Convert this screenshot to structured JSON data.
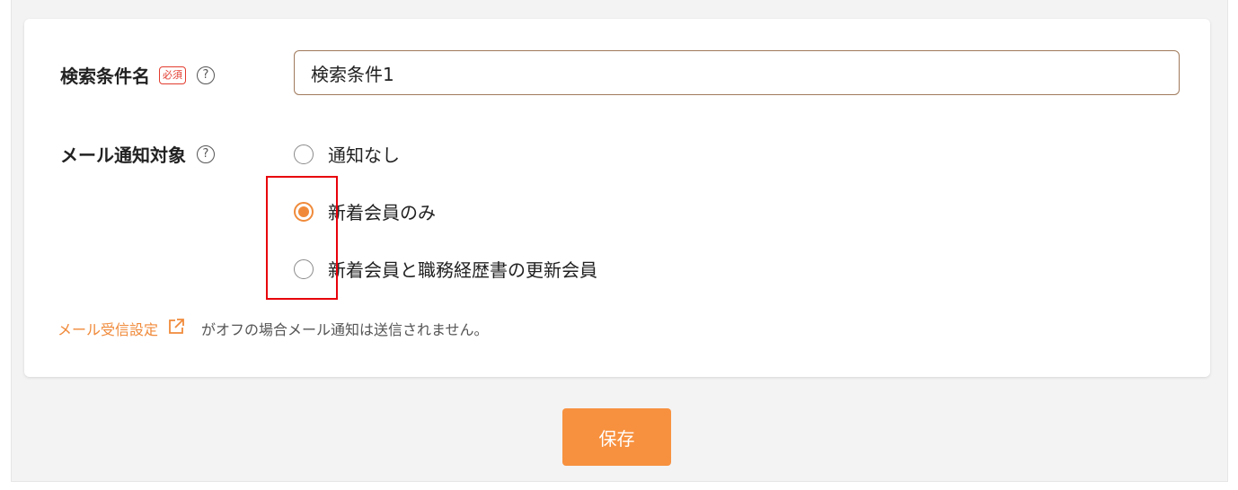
{
  "form": {
    "search_name": {
      "label": "検索条件名",
      "required_badge": "必須",
      "help": "?",
      "value": "検索条件1"
    },
    "mail_target": {
      "label": "メール通知対象",
      "help": "?",
      "options": [
        {
          "label": "通知なし",
          "selected": false
        },
        {
          "label": "新着会員のみ",
          "selected": true
        },
        {
          "label": "新着会員と職務経歴書の更新会員",
          "selected": false
        }
      ]
    },
    "note": {
      "link_text": "メール受信設定",
      "link_icon": "external-link-icon",
      "text": "がオフの場合メール通知は送信されません。"
    }
  },
  "actions": {
    "save_label": "保存"
  },
  "colors": {
    "accent": "#f7913f",
    "required": "#e23c2f",
    "highlight_box": "#e8000b"
  }
}
